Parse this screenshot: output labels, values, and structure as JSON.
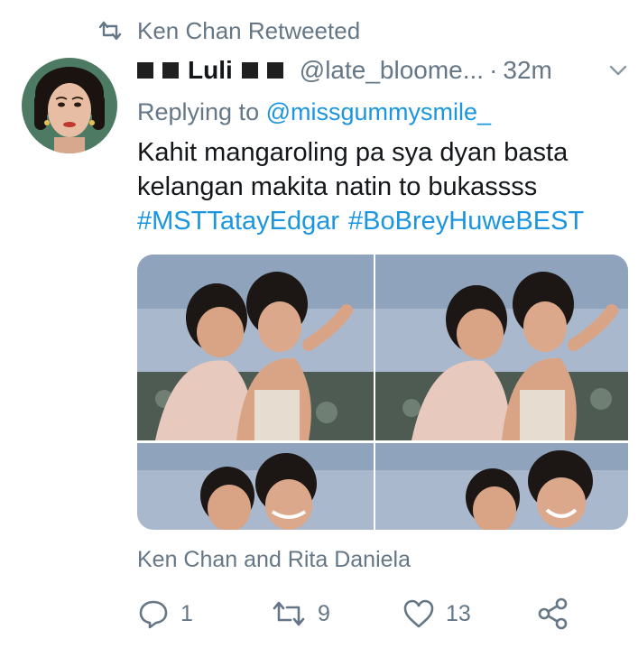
{
  "retweet": {
    "label": "Ken Chan Retweeted",
    "icon": "retweet-icon"
  },
  "tweet": {
    "author_name": "Luli",
    "handle": "@late_bloome...",
    "separator": "·",
    "time": "32m",
    "reply_prefix": "Replying to",
    "reply_to": "@missgummysmile_",
    "text_line1": "Kahit mangaroling pa sya dyan basta",
    "text_line2": "kelangan makita natin to bukassss",
    "hashtags": [
      "#MSTTatayEdgar",
      "#BoBreyHuweBEST"
    ],
    "tagged": "Ken Chan and Rita Daniela"
  },
  "actions": {
    "reply_count": "1",
    "retweet_count": "9",
    "like_count": "13"
  },
  "colors": {
    "link": "#1b95e0",
    "muted": "#657786",
    "text": "#14171a",
    "pillow": "#a9b8cc",
    "skin": "#d9a486",
    "shirt": "#e8c9bd",
    "hair": "#1c1614"
  }
}
